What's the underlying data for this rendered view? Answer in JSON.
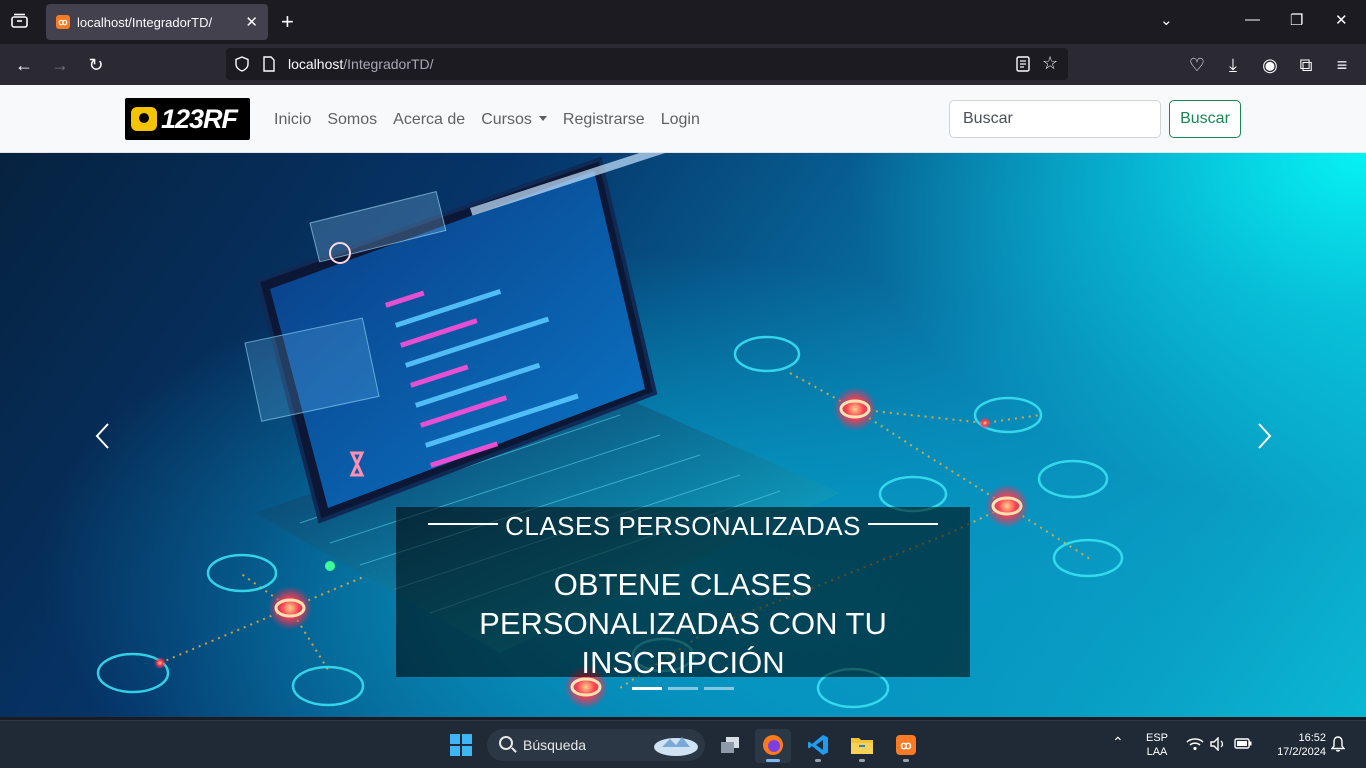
{
  "browser": {
    "tab_title": "localhost/IntegradorTD/",
    "url_host": "localhost",
    "url_path": "/IntegradorTD/"
  },
  "site": {
    "logo_text": "123RF",
    "nav_items": [
      "Inicio",
      "Somos",
      "Acerca de",
      "Cursos",
      "Registrarse",
      "Login"
    ],
    "search_placeholder": "Buscar",
    "search_button": "Buscar"
  },
  "carousel": {
    "caption_title": "CLASES PERSONALIZADAS",
    "caption_text": "OBTENE CLASES PERSONALIZADAS CON TU INSCRIPCIÓN",
    "slide_count": 3,
    "active_slide": 1
  },
  "taskbar": {
    "search_label": "Búsqueda",
    "lang": "ESP",
    "layout": "LAA",
    "time": "16:52",
    "date": "17/2/2024"
  }
}
